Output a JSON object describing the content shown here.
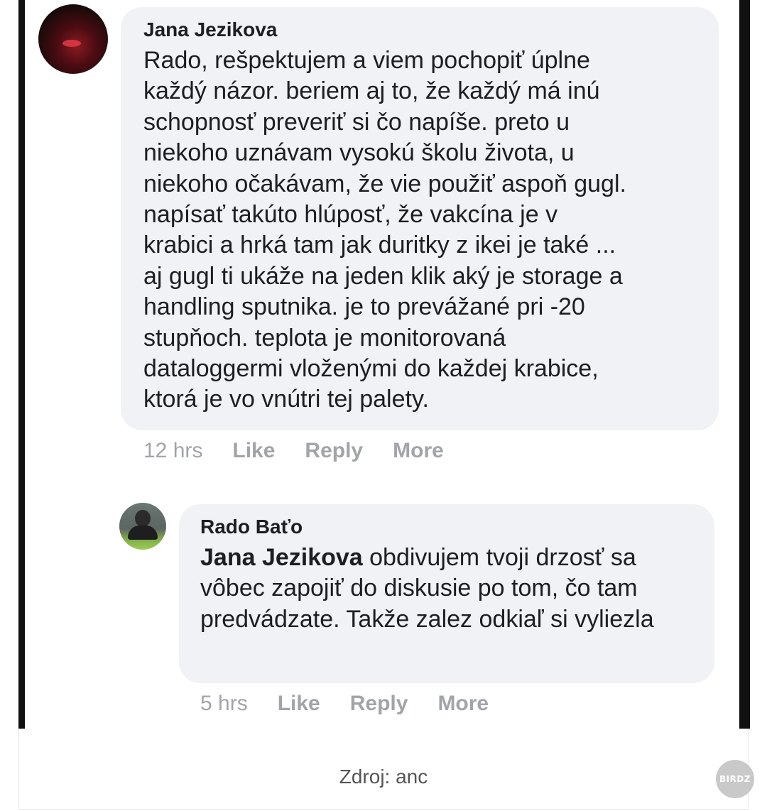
{
  "comment": {
    "author": "Jana Jezikova",
    "text": "Rado, rešpektujem a viem pochopiť úplne\nkaždý názor. beriem aj to, že každý má inú\nschopnosť preveriť si čo napíše. preto u\nniekoho uznávam vysokú školu života, u\nniekoho očakávam, že vie použiť aspoň gugl.\nnapísať takúto hlúposť, že vakcína je v\nkrabici a hrká tam jak duritky z ikei je také ...\naj gugl ti ukáže na jeden klik aký je storage a\nhandling sputnika. je to prevážané pri -20\nstupňoch. teplota je monitorovaná\ndataloggermi vloženými do každej krabice,\nktorá je vo vnútri tej palety.",
    "time": "12 hrs",
    "like_label": "Like",
    "reply_label": "Reply",
    "more_label": "More"
  },
  "reply": {
    "author": "Rado Baťo",
    "mention": "Jana Jezikova",
    "text": " obdivujem tvoji drzosť sa vôbec zapojiť do diskusie po tom, čo tam predvádzate. Takže zalez odkiaľ si vyliezla",
    "time": "5 hrs",
    "like_label": "Like",
    "reply_label": "Reply",
    "more_label": "More"
  },
  "caption": "Zdroj: anc",
  "watermark": "BIRDZ"
}
